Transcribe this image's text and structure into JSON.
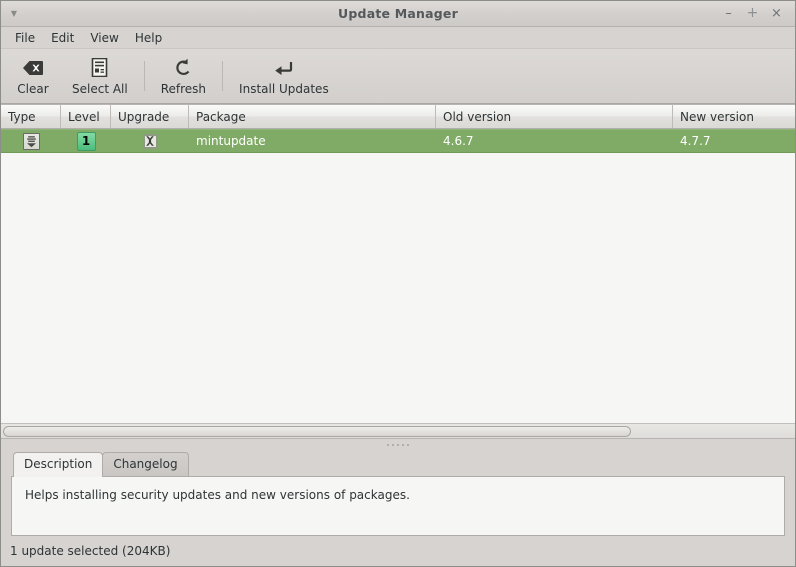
{
  "window": {
    "title": "Update Manager",
    "menu_arrow_icon": "triangle-down-icon",
    "controls": {
      "minimize": "–",
      "maximize": "+",
      "close": "×"
    }
  },
  "menubar": {
    "items": [
      {
        "label": "File"
      },
      {
        "label": "Edit"
      },
      {
        "label": "View"
      },
      {
        "label": "Help"
      }
    ]
  },
  "toolbar": {
    "buttons": [
      {
        "label": "Clear",
        "icon": "backspace-clear-icon"
      },
      {
        "label": "Select All",
        "icon": "select-all-list-icon"
      },
      {
        "label": "Refresh",
        "icon": "refresh-arrow-icon"
      },
      {
        "label": "Install Updates",
        "icon": "enter-return-arrow-icon"
      }
    ]
  },
  "table": {
    "columns": [
      {
        "label": "Type"
      },
      {
        "label": "Level"
      },
      {
        "label": "Upgrade"
      },
      {
        "label": "Package"
      },
      {
        "label": "Old version"
      },
      {
        "label": "New version"
      }
    ],
    "rows": [
      {
        "selected": true,
        "type_icon": "package-download-icon",
        "level": "1",
        "upgrade_checked": true,
        "upgrade_icon": "checkbox-checked-icon",
        "package": "mintupdate",
        "old_version": "4.6.7",
        "new_version": "4.7.7"
      }
    ]
  },
  "scrollbar": {
    "orientation": "horizontal",
    "thumb_fraction": "79.5%"
  },
  "splitter": {
    "icon": "grip-dots-icon"
  },
  "tabs": [
    {
      "label": "Description",
      "active": true
    },
    {
      "label": "Changelog",
      "active": false
    }
  ],
  "description": {
    "text": "Helps installing security updates and new versions of packages."
  },
  "statusbar": {
    "text": "1 update selected (204KB)"
  },
  "colors": {
    "selection_green": "#80ab67",
    "level_badge_green": "#4bbd7c",
    "window_chrome": "#d6d3d0",
    "list_background": "#f6f6f4",
    "title_text": "#55595c"
  }
}
